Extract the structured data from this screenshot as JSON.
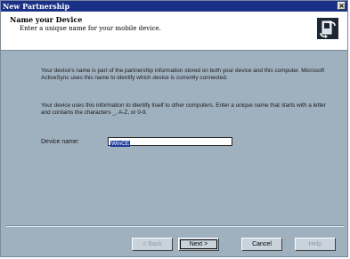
{
  "window": {
    "title": "New Partnership",
    "close_symbol": "✕"
  },
  "header": {
    "title": "Name your Device",
    "subtitle": "Enter a unique name for your mobile device.",
    "icon": "device-sync-icon"
  },
  "body": {
    "paragraph1": "Your device's name is part of the partnership information stored on both your device and this computer. Microsoft ActiveSync uses this name to identify which device is currently connected.",
    "paragraph2": "Your device uses this information to identify itself to other computers. Enter a unique name that starts with a letter and contains the characters _, A-Z, or 0-9."
  },
  "form": {
    "device_name_label": "Device name:",
    "device_name_value": "WinCE"
  },
  "buttons": {
    "back": "< Back",
    "next": "Next >",
    "cancel": "Cancel",
    "help": "Help"
  }
}
